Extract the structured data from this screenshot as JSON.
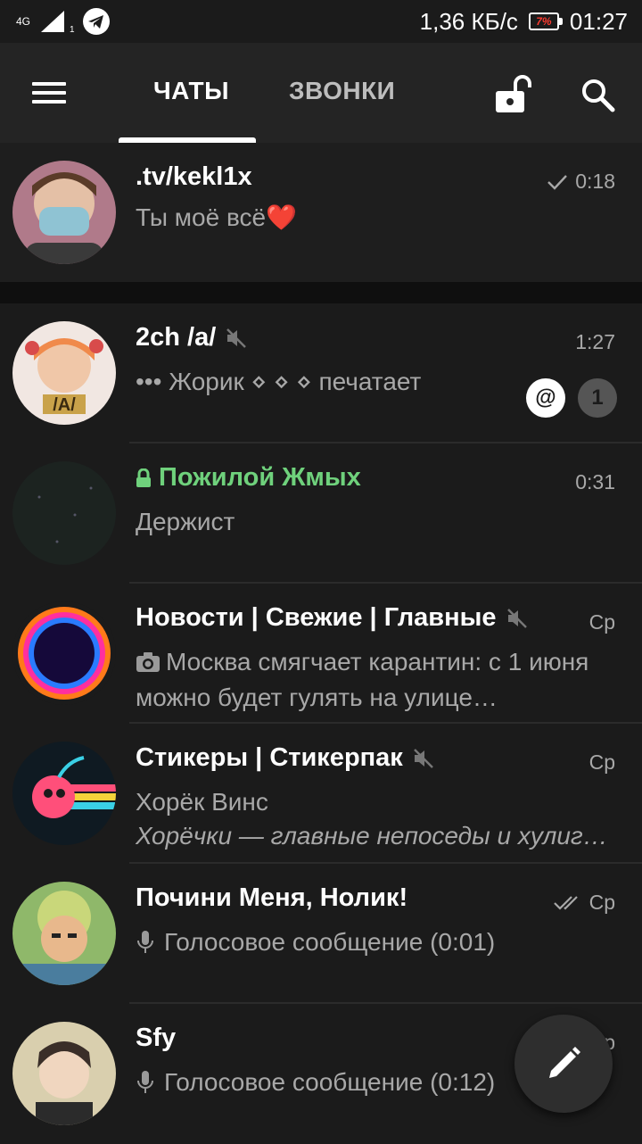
{
  "status_bar": {
    "network": "4G",
    "sim_slot": "1",
    "speed": "1,36 КБ/с",
    "battery": "7%",
    "time": "01:27",
    "icons": [
      "signal-icon",
      "telegram-icon",
      "battery-icon"
    ]
  },
  "header": {
    "tabs": [
      {
        "label": "ЧАТЫ",
        "active": true
      },
      {
        "label": "ЗВОНКИ",
        "active": false
      }
    ],
    "icons": [
      "menu-icon",
      "lock-open-icon",
      "search-icon"
    ]
  },
  "chats": [
    {
      "name": ".tv/kekl1x",
      "time": "0:18",
      "status": "sent",
      "line1": "Ты моё всё❤️",
      "pinned": true
    },
    {
      "name": "2ch /a/",
      "time": "1:27",
      "muted": true,
      "line1": "••• Жорик ⋄ ⋄ ⋄ печатает",
      "mention": "@",
      "unread": "1"
    },
    {
      "name": "Пожилой Жмых",
      "time": "0:31",
      "secret": true,
      "line1": "Держист"
    },
    {
      "name": "Новости | Свежие | Главные",
      "time": "Ср",
      "muted": true,
      "line1": "Москва смягчает карантин: с 1 июня можно будет гулять на улице…",
      "attachment": "camera-icon"
    },
    {
      "name": "Стикеры | Стикерпак",
      "time": "Ср",
      "muted": true,
      "line1": "Хорёк Винс",
      "line2": "Хорёчки — главные непоседы и хулиг…"
    },
    {
      "name": "Почини Меня, Нолик!",
      "time": "Ср",
      "status": "read",
      "line1": "Голосовое сообщение (0:01)",
      "attachment": "mic-icon"
    },
    {
      "name": "Sfy",
      "time": "Ср",
      "line1": "Голосовое сообщение (0:12)",
      "attachment": "mic-icon"
    }
  ],
  "fab": {
    "icon": "pencil-icon"
  },
  "colors": {
    "background": "#1b1b1b",
    "header": "#242424",
    "secret_chat": "#6fd17c",
    "secondary_text": "#a8a8a8"
  }
}
